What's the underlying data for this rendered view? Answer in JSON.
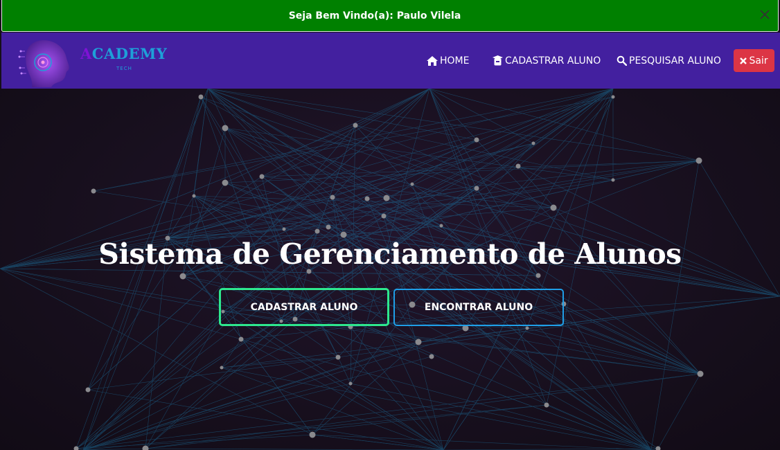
{
  "alert": {
    "message": "Seja Bem Vindo(a): Paulo Vilela",
    "close_icon": "close-icon",
    "color": "#008000"
  },
  "navbar": {
    "color": "#43209f",
    "logo": {
      "first_letter": "A",
      "rest": "CADEMY",
      "tagline": "TECH"
    },
    "links": {
      "home": "HOME",
      "cadastrar": "CADASTRAR ALUNO",
      "pesquisar": "PESQUISAR ALUNO"
    },
    "logout_label": "Sair",
    "logout_color": "#dc3545"
  },
  "hero": {
    "title": "Sistema de Gerenciamento de Alunos",
    "buttons": {
      "cadastrar": "CADASTRAR ALUNO",
      "encontrar": "ENCONTRAR ALUNO"
    },
    "accent_green": "#2ee88e",
    "accent_blue": "#1f9fe8"
  }
}
